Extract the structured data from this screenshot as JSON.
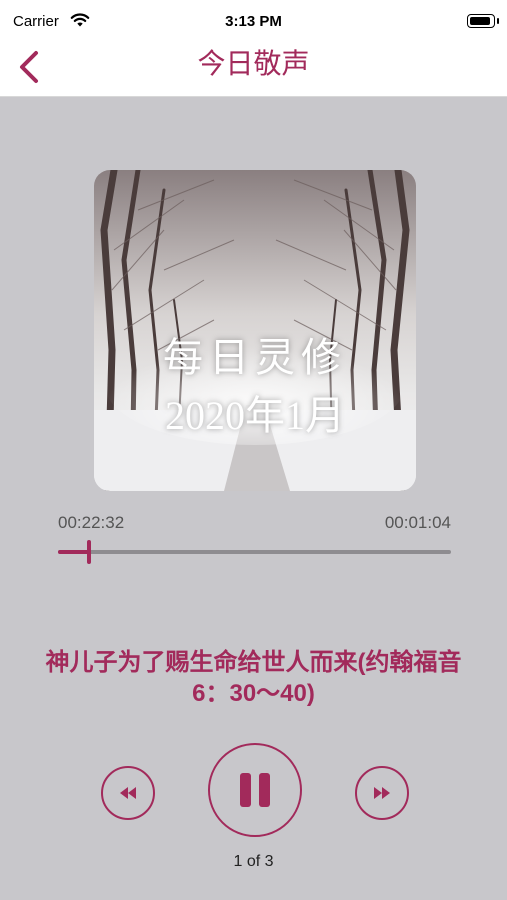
{
  "status_bar": {
    "carrier": "Carrier",
    "time": "3:13 PM"
  },
  "nav": {
    "title": "今日敬声",
    "back_icon": "chevron-left-icon"
  },
  "artwork": {
    "line1": "每日灵修",
    "line2": "2020年1月"
  },
  "player": {
    "elapsed": "00:22:32",
    "remaining": "00:01:04",
    "progress_fraction": 0.08,
    "episode_title": "神儿子为了赐生命给世人而来(约翰福音6：30～40)",
    "track_counter": "1 of 3",
    "rewind_icon": "rewind-icon",
    "pause_icon": "pause-icon",
    "forward_icon": "fast-forward-icon"
  },
  "colors": {
    "accent": "#a22a5b",
    "background": "#c8c7cb"
  }
}
